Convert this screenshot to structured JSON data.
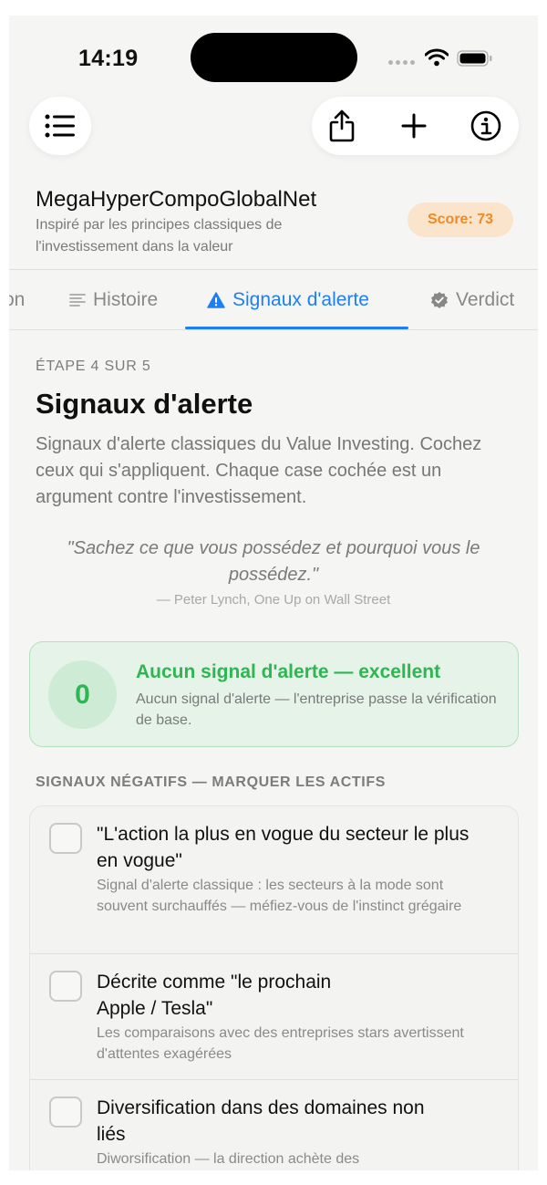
{
  "status_bar": {
    "time": "14:19"
  },
  "toolbar": {
    "menu_icon": "list-icon",
    "actions": [
      {
        "name": "share",
        "icon": "share-icon"
      },
      {
        "name": "add",
        "icon": "plus-icon"
      },
      {
        "name": "info",
        "icon": "info-icon"
      }
    ]
  },
  "header": {
    "company_name": "MegaHyperCompoGlobalNet",
    "subtitle": "Inspiré par les principes classiques de l'investissement dans la valeur",
    "score_label": "Score: 73"
  },
  "tabs": [
    {
      "label": "on",
      "icon": "",
      "active": false
    },
    {
      "label": "Histoire",
      "icon": "text-lines-icon",
      "active": false
    },
    {
      "label": "Signaux d'alerte",
      "icon": "warning-icon",
      "active": true
    },
    {
      "label": "Verdict",
      "icon": "verified-badge-icon",
      "active": false
    }
  ],
  "content": {
    "step_label": "ÉTAPE 4 SUR 5",
    "title": "Signaux d'alerte",
    "description": "Signaux d'alerte classiques du Value Investing. Cochez ceux qui s'appliquent. Chaque case cochée est un argument contre l'investissement.",
    "quote": "\"Sachez ce que vous possédez et pourquoi vous le possédez.\"",
    "attribution": "— Peter Lynch, One Up on Wall Street"
  },
  "summary": {
    "count": "0",
    "title": "Aucun signal d'alerte — excellent",
    "text": "Aucun signal d'alerte — l'entreprise passe la vérification de base."
  },
  "red_flags": {
    "heading": "SIGNAUX NÉGATIFS — MARQUER LES ACTIFS",
    "items": [
      {
        "title": "\"L'action la plus en vogue du secteur le plus en vogue\"",
        "description": "Signal d'alerte classique : les secteurs à la mode sont souvent surchauffés — méfiez-vous de l'instinct grégaire",
        "checked": false
      },
      {
        "title": "Décrite comme \"le prochain Apple / Tesla\"",
        "description": "Les comparaisons avec des entreprises stars avertissent d'attentes exagérées",
        "checked": false
      },
      {
        "title": "Diversification dans des domaines non liés",
        "description": "Diworsification — la direction achète des",
        "checked": false
      }
    ]
  },
  "colors": {
    "accent_blue": "#1e7ef2",
    "success_green": "#2fb552",
    "score_orange": "#f08a24"
  }
}
